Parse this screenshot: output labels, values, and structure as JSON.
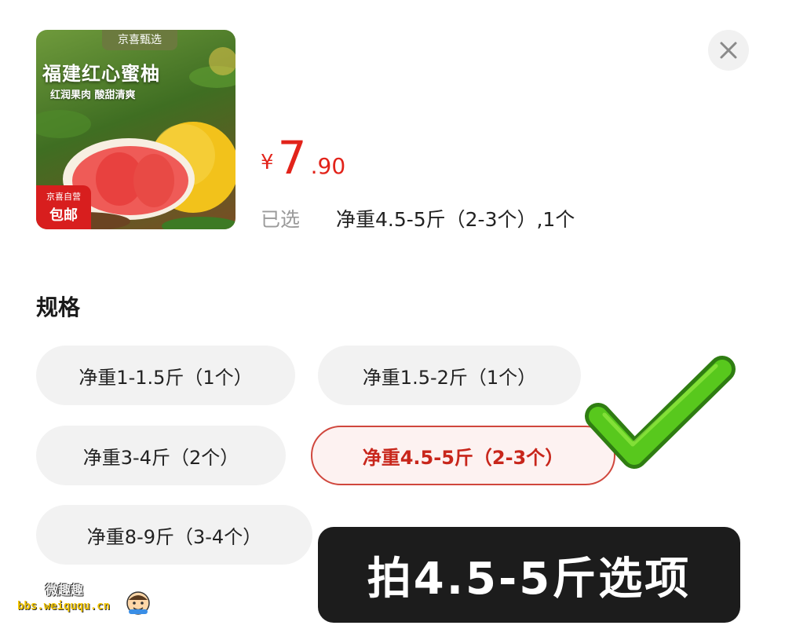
{
  "product": {
    "brand_tag": "京喜甄选",
    "title": "福建红心蜜柚",
    "tagline": "红润果肉 酸甜清爽",
    "badge_line1": "京喜自营",
    "badge_line2": "包邮"
  },
  "price": {
    "symbol": "¥",
    "integer": "7",
    "decimal": ".90",
    "color": "#e2231a"
  },
  "selection": {
    "label": "已选",
    "value": "净重4.5-5斤（2-3个）,1个"
  },
  "spec": {
    "title": "规格",
    "options": [
      {
        "label": "净重1-1.5斤（1个）",
        "selected": false
      },
      {
        "label": "净重1.5-2斤（1个）",
        "selected": false
      },
      {
        "label": "净重3-4斤（2个）",
        "selected": false
      },
      {
        "label": "净重4.5-5斤（2-3个）",
        "selected": true
      },
      {
        "label": "净重8-9斤（3-4个）",
        "selected": false
      }
    ]
  },
  "close_icon": "close-icon",
  "check_icon": "green-checkmark-icon",
  "banner": {
    "text": "拍4.5-5斤选项"
  },
  "watermark": {
    "chinese": "微趣趣",
    "url": "bbs.weiququ.cn"
  }
}
